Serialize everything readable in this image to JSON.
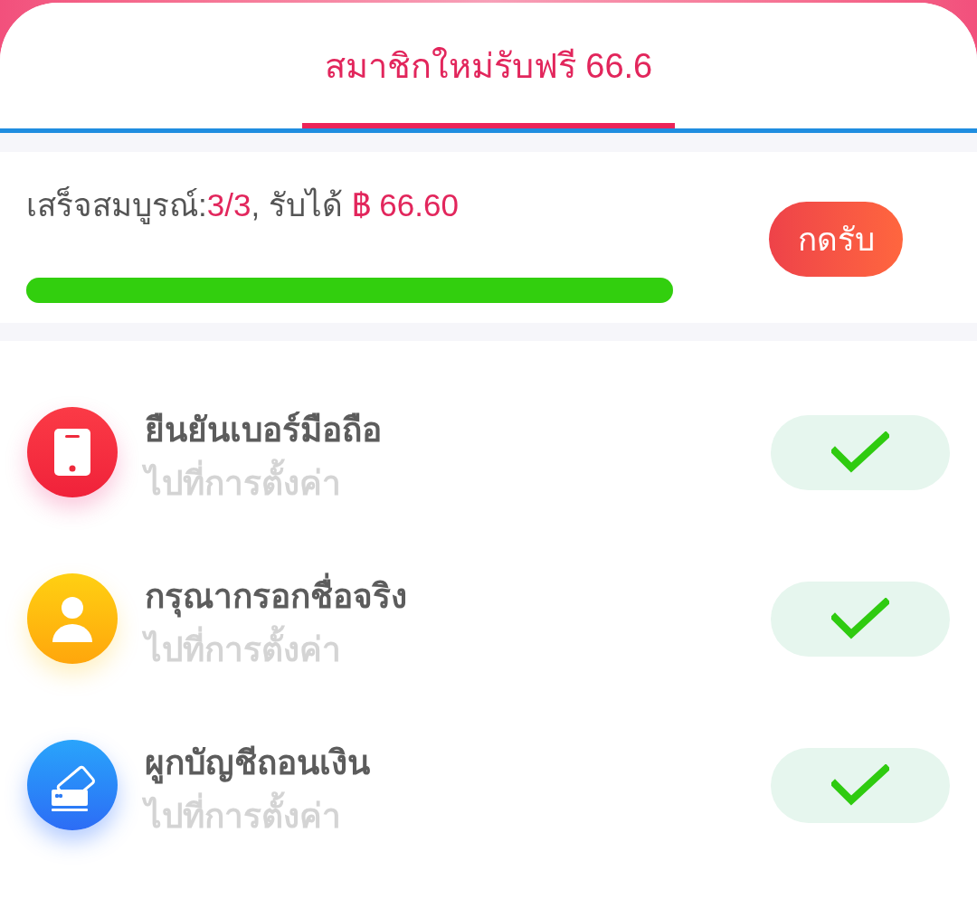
{
  "tabs": [
    {
      "label": "สมาชิกใหม่รับฟรี 66.6",
      "selected": true
    }
  ],
  "progress": {
    "segments": [
      {
        "text": "เสร็จสมบูรณ์:",
        "highlight": false
      },
      {
        "text": "3/3",
        "highlight": true
      },
      {
        "text": ", รับได้ ",
        "highlight": false
      },
      {
        "text": "฿ 66.60",
        "highlight": true
      }
    ],
    "level": 1,
    "claim_button": "กดรับ"
  },
  "tasks": [
    {
      "kind": "phone",
      "title": "ยืนยันเบอร์มือถือ",
      "subtitle": "ไปที่การตั้งค่า",
      "done": true
    },
    {
      "kind": "person",
      "title": "กรุณากรอกชื่อจริง",
      "subtitle": "ไปที่การตั้งค่า",
      "done": true
    },
    {
      "kind": "cards",
      "title": "ผูกบัญชีถอนเงิน",
      "subtitle": "ไปที่การตั้งค่า",
      "done": true
    }
  ]
}
